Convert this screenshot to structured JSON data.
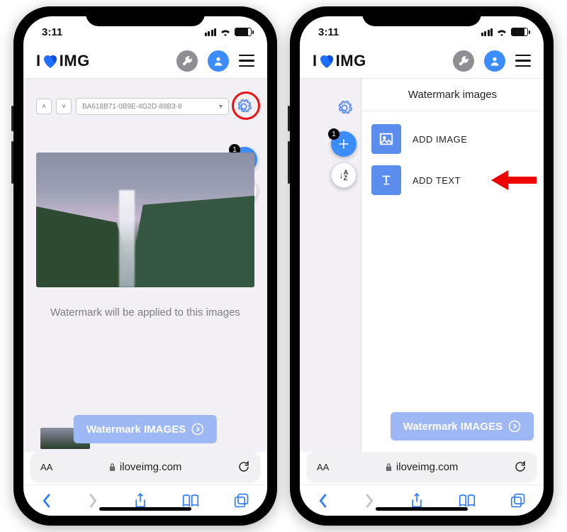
{
  "status": {
    "time": "3:11"
  },
  "header": {
    "logo_i": "I",
    "logo_img": "IMG"
  },
  "toolbar": {
    "file_id": "BA618B71-0B9E-4G2D-88B3-8",
    "badge_count": "1",
    "sort_label": "AZ"
  },
  "caption": "Watermark will be applied to this images",
  "cta_label": "Watermark IMAGES",
  "browser": {
    "aa": "AA",
    "domain": "iloveimg.com"
  },
  "panel": {
    "title": "Watermark images",
    "add_image_label": "ADD IMAGE",
    "add_text_label": "ADD TEXT"
  }
}
